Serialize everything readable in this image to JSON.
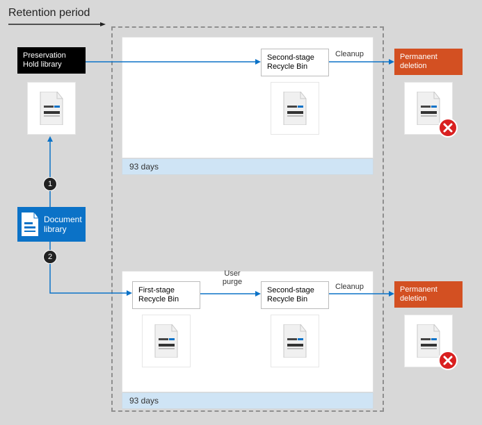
{
  "header": {
    "retention": "Retention period"
  },
  "frame": {
    "duration": "93 days"
  },
  "labels": {
    "user_purge": "User\npurge",
    "cleanup": "Cleanup"
  },
  "boxes": {
    "preservation_hold": "Preservation\nHold library",
    "second_stage": "Second-stage\nRecycle Bin",
    "first_stage": "First-stage\nRecycle Bin",
    "permanent_deletion": "Permanent\ndeletion",
    "document_library": "Document\nlibrary"
  },
  "steps": {
    "one": "1",
    "two": "2"
  },
  "icons": {
    "file": "file-icon",
    "doc_lib": "doc-library-icon",
    "delete_badge": "delete-x-icon"
  }
}
